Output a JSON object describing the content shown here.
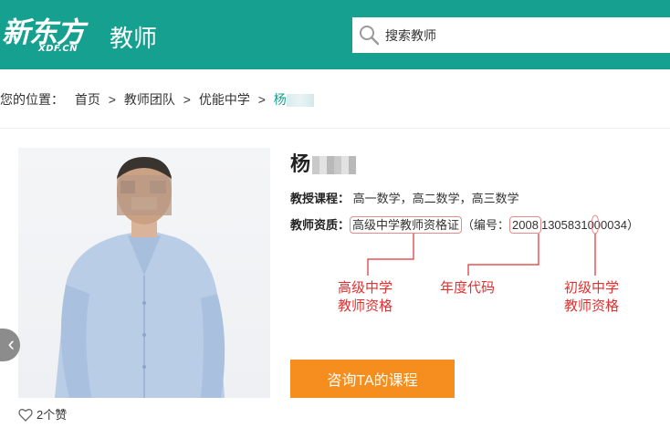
{
  "header": {
    "logo_main": "新东方",
    "logo_sub": "XDF.CN",
    "site_name": "教师",
    "search_value": "搜索教师"
  },
  "breadcrumb": {
    "prefix": "您的位置：",
    "items": [
      "首页",
      "教师团队",
      "优能中学"
    ],
    "current": "杨",
    "separator": ">"
  },
  "teacher": {
    "name": "杨",
    "courses_label": "教授课程：",
    "courses": "高一数学，高二数学，高三数学",
    "qualification_label": "教师资质：",
    "qualification": "高级中学教师资格证",
    "number_prefix": "（编号：",
    "number_year": "2008",
    "number_rest": "1305831000034",
    "number_suffix": "）"
  },
  "annotations": {
    "senior_line1": "高级中学",
    "senior_line2": "教师资格",
    "year_code": "年度代码",
    "junior_line1": "初级中学",
    "junior_line2": "教师资格"
  },
  "actions": {
    "consult_label": "咨询TA的课程",
    "likes_label": "2个赞"
  },
  "colors": {
    "brand_teal": "#15a08f",
    "button_orange": "#f58e1e",
    "annotation_red": "#e03030"
  }
}
